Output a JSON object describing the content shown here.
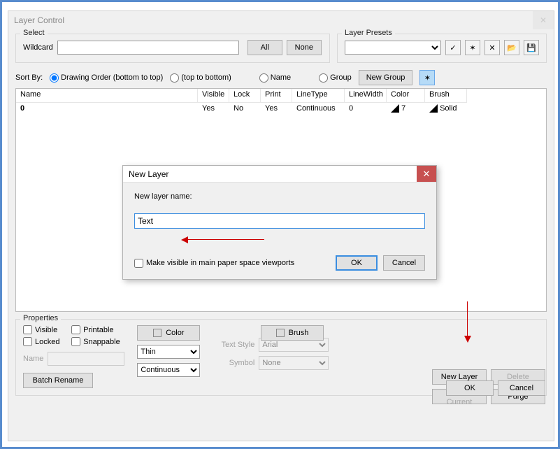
{
  "window": {
    "title": "Layer Control"
  },
  "select": {
    "legend": "Select",
    "wildcard_label": "Wildcard",
    "wildcard_value": "",
    "all_btn": "All",
    "none_btn": "None"
  },
  "presets": {
    "legend": "Layer Presets",
    "value": "",
    "check_label": "✓",
    "star_label": "✶",
    "x_label": "✕"
  },
  "sortby": {
    "label": "Sort By:",
    "opt1": "Drawing Order (bottom to top)",
    "opt2": "(top to bottom)",
    "opt3": "Name",
    "opt4": "Group",
    "newgroup": "New Group",
    "del": "✶"
  },
  "grid": {
    "headers": {
      "name": "Name",
      "visible": "Visible",
      "lock": "Lock",
      "print": "Print",
      "linetype": "LineType",
      "linewidth": "LineWidth",
      "color": "Color",
      "brush": "Brush"
    },
    "rows": [
      {
        "name": "0",
        "visible": "Yes",
        "lock": "No",
        "print": "Yes",
        "linetype": "Continuous",
        "linewidth": "0",
        "color": "7",
        "brush": "Solid"
      }
    ]
  },
  "props": {
    "legend": "Properties",
    "visible": "Visible",
    "printable": "Printable",
    "locked": "Locked",
    "snappable": "Snappable",
    "name_label": "Name",
    "name_value": "",
    "batch": "Batch Rename",
    "color_btn": "Color",
    "thin": "Thin",
    "continuous": "Continuous",
    "brush_btn": "Brush",
    "textstyle_label": "Text Style",
    "textstyle_value": "Arial",
    "symbol_label": "Symbol",
    "symbol_value": "None"
  },
  "rightbtns": {
    "newlayer": "New Layer",
    "delete": "Delete",
    "makecurrent": "Make Current",
    "purge": "Purge"
  },
  "bottom": {
    "ok": "OK",
    "cancel": "Cancel"
  },
  "modal": {
    "title": "New Layer",
    "label": "New layer name:",
    "value": "Text",
    "checkbox": "Make visible in main paper space viewports",
    "ok": "OK",
    "cancel": "Cancel"
  }
}
